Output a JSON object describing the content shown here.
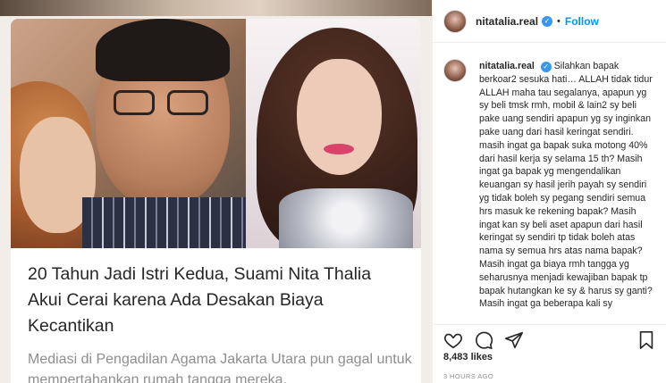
{
  "article": {
    "headline": "20 Tahun Jadi Istri Kedua, Suami Nita Thalia Akui Cerai karena Ada Desakan Biaya Kecantikan",
    "lede": "Mediasi di Pengadilan Agama Jakarta Utara pun gagal untuk mempertahankan rumah tangga mereka."
  },
  "post": {
    "username": "nitatalia.real",
    "follow_label": "Follow",
    "separator": "•",
    "verified_icon": "verified-badge-icon",
    "caption_username": "nitatalia.real",
    "caption_text": "Silahkan bapak berkoar2 sesuka hati… ALLAH tidak tidur ALLAH maha tau segalanya, apapun yg sy beli tmsk rmh, mobil & lain2 sy beli pake uang sendiri apapun yg sy inginkan pake uang dari hasil keringat sendiri. masih ingat ga bapak suka motong 40% dari hasil kerja sy selama 15 th? Masih ingat ga bapak yg mengendalikan keuangan sy hasil jerih payah sy sendiri yg tidak boleh sy pegang sendiri semua hrs masuk ke rekening bapak? Masih ingat kan sy beli aset apapun dari hasil keringat sy sendiri tp tidak boleh atas nama sy semua hrs atas nama bapak? Masih ingat ga biaya rmh tangga yg seharusnya menjadi kewajiban bapak tp bapak hutangkan ke sy & harus sy ganti? Masih ingat ga beberapa kali sy",
    "likes": "8,483 likes",
    "timestamp": "3 HOURS AGO"
  },
  "icons": {
    "like": "heart-icon",
    "comment": "comment-icon",
    "share": "share-icon",
    "save": "bookmark-icon"
  }
}
